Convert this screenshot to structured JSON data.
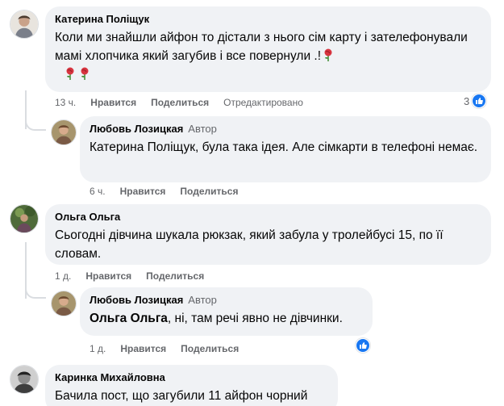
{
  "colors": {
    "bubble": "#f0f2f5",
    "meta": "#65676b",
    "like": "#1877f2"
  },
  "rose_icon": "rose-emoji",
  "comments": [
    {
      "author": "Катерина Поліщук",
      "text": "Коли ми знайшли айфон то дістали з нього сім карту і зателефонували мамі хлопчика який загубив і все повернули .!",
      "time": "13 ч.",
      "like": "Нравится",
      "share": "Поделиться",
      "edited": "Отредактировано",
      "reactions": "3"
    },
    {
      "author": "Любовь Лозицкая",
      "badge": "Автор",
      "text": "Катерина Поліщук, була така ідея. Але сімкарти в телефоні немає.",
      "time": "6 ч.",
      "like": "Нравится",
      "share": "Поделиться"
    },
    {
      "author": "Ольга Ольга",
      "text": "Сьогодні дівчина шукала рюкзак, який забула у тролейбусі 15, по її словам.",
      "time": "1 д.",
      "like": "Нравится",
      "share": "Поделиться"
    },
    {
      "author": "Любовь Лозицкая",
      "badge": "Автор",
      "mention": "Ольга Ольга",
      "text": ", ні, там речі явно не дівчинки.",
      "time": "1 д.",
      "like": "Нравится",
      "share": "Поделиться",
      "reactions": ""
    },
    {
      "author": "Каринка Михайловна",
      "text": "Бачила пост, що загубили 11 айфон чорний"
    }
  ]
}
